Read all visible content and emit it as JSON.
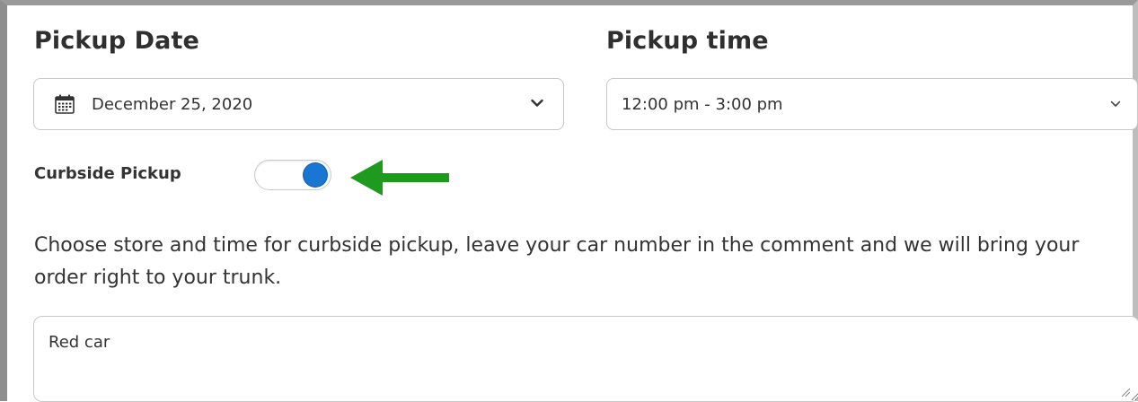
{
  "pickup_date": {
    "label": "Pickup Date",
    "value": "December 25, 2020",
    "icon": "calendar-icon"
  },
  "pickup_time": {
    "label": "Pickup time",
    "value": "12:00 pm - 3:00 pm"
  },
  "curbside": {
    "label": "Curbside Pickup",
    "enabled": true,
    "accent_color": "#1976d2",
    "arrow_color": "#1e9a1e"
  },
  "description": "Choose store and time for curbside pickup, leave your car number in the comment and we will bring your order right to your trunk.",
  "comment": {
    "value": "Red car"
  }
}
